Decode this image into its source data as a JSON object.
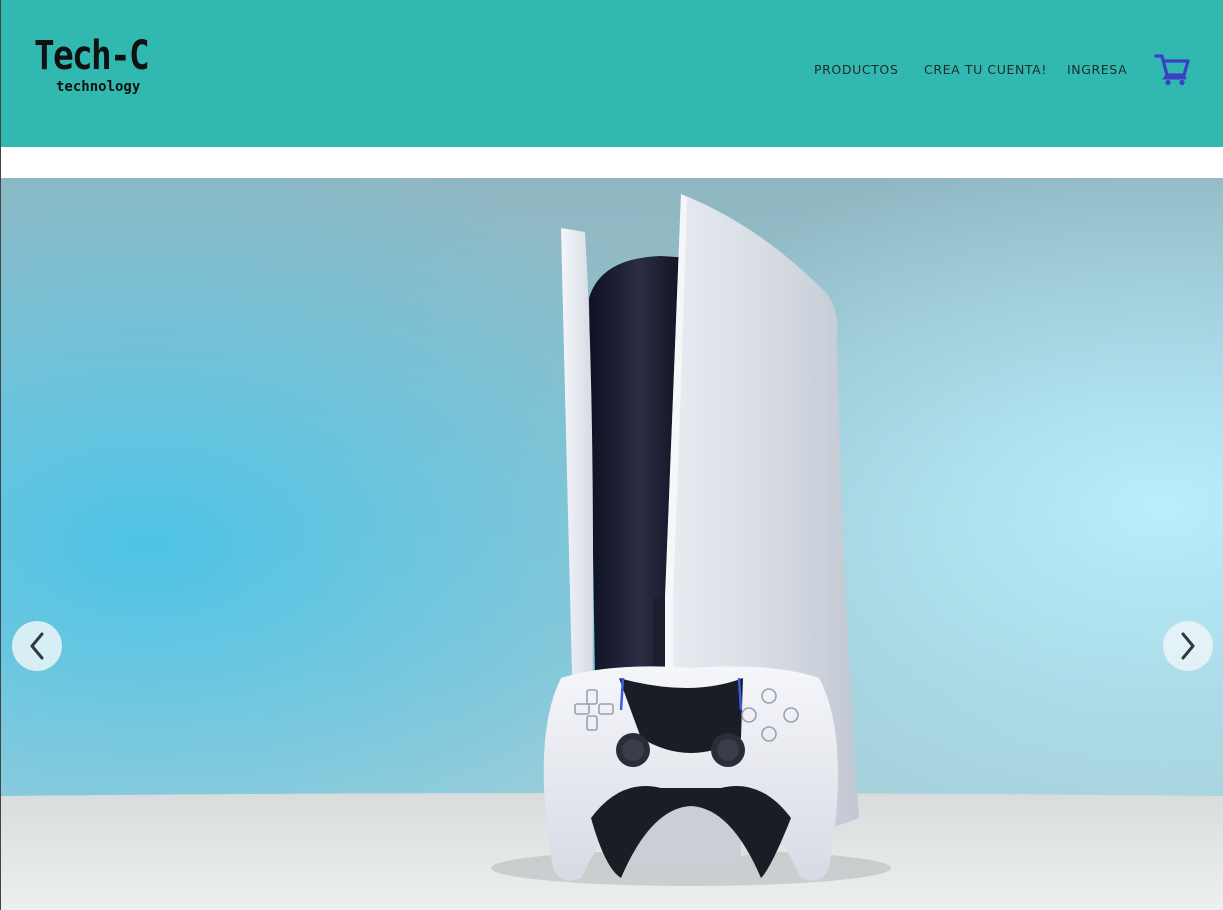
{
  "brand": {
    "name": "Tech-C",
    "tagline": "technology"
  },
  "nav": {
    "items": [
      {
        "label": "PRODUCTOS"
      },
      {
        "label": "CREA TU CUENTA!"
      },
      {
        "label": "INGRESA"
      }
    ],
    "cart_icon": "shopping-cart-icon"
  },
  "hero": {
    "image": "game-console-with-controller-photo",
    "prev_icon": "chevron-left-icon",
    "next_icon": "chevron-right-icon"
  },
  "colors": {
    "header_bg": "#31b8b1",
    "cart_icon": "#3b3fc8",
    "nav_text": "#1f2a2a"
  }
}
